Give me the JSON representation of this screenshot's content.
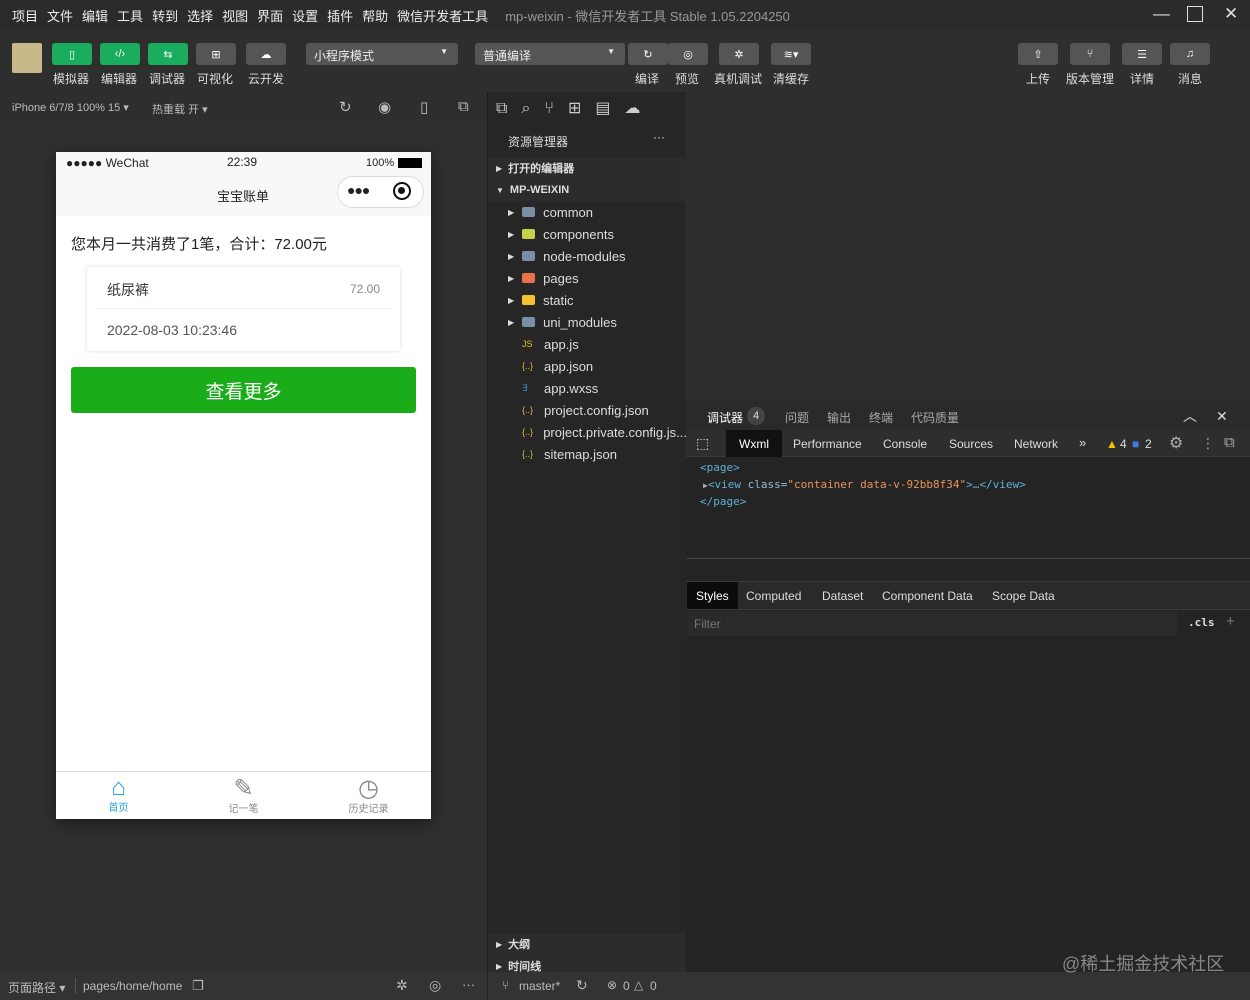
{
  "menubar": {
    "items": [
      "项目",
      "文件",
      "编辑",
      "工具",
      "转到",
      "选择",
      "视图",
      "界面",
      "设置",
      "插件",
      "帮助",
      "微信开发者工具"
    ],
    "title": "mp-weixin - 微信开发者工具 Stable 1.05.2204250"
  },
  "toolbar": {
    "left": [
      {
        "label": "模拟器",
        "icon": "phone-icon"
      },
      {
        "label": "编辑器",
        "icon": "code-icon"
      },
      {
        "label": "调试器",
        "icon": "sliders-icon"
      },
      {
        "label": "可视化",
        "icon": "layout-icon"
      },
      {
        "label": "云开发",
        "icon": "cloud-icon"
      }
    ],
    "mode_select": "小程序模式",
    "compile_select": "普通编译",
    "middle": [
      {
        "label": "编译",
        "icon": "refresh-icon"
      },
      {
        "label": "预览",
        "icon": "eye-icon"
      },
      {
        "label": "真机调试",
        "icon": "bug-icon"
      },
      {
        "label": "清缓存",
        "icon": "layers-icon"
      }
    ],
    "right": [
      {
        "label": "上传",
        "icon": "upload-icon"
      },
      {
        "label": "版本管理",
        "icon": "branch-icon"
      },
      {
        "label": "详情",
        "icon": "menu-icon"
      },
      {
        "label": "消息",
        "icon": "bell-icon"
      }
    ],
    "accent": "#1aad5f"
  },
  "subbar": {
    "device": "iPhone 6/7/8 100% 15 ▾",
    "hot_reload": "热重载 开 ▾"
  },
  "phone": {
    "status": {
      "carrier": "●●●●● WeChat",
      "time": "22:39",
      "battery": "100%"
    },
    "nav_title": "宝宝账单",
    "summary": "您本月一共消费了1笔，合计：72.00元",
    "record": {
      "name": "纸尿裤",
      "amount": "72.00",
      "time": "2022-08-03 10:23:46"
    },
    "more_button": "查看更多",
    "button_color": "#1aad19",
    "tabbar": [
      {
        "label": "首页",
        "icon": "home-icon",
        "active": true
      },
      {
        "label": "记一笔",
        "icon": "pencil-icon"
      },
      {
        "label": "历史记录",
        "icon": "history-icon"
      }
    ]
  },
  "explorer": {
    "title": "资源管理器",
    "more": "···",
    "open_editors": "打开的编辑器",
    "root": "MP-WEIXIN",
    "folders": [
      {
        "name": "common",
        "color": "#7a8fa6"
      },
      {
        "name": "components",
        "color": "#c5d34a"
      },
      {
        "name": "node-modules",
        "color": "#7a8fa6"
      },
      {
        "name": "pages",
        "color": "#e8734a"
      },
      {
        "name": "static",
        "color": "#f2c12e"
      },
      {
        "name": "uni_modules",
        "color": "#7a8fa6"
      }
    ],
    "files": [
      {
        "name": "app.js",
        "icon": "js-file-icon",
        "symbol": "JS",
        "color": "#e8c21c"
      },
      {
        "name": "app.json",
        "icon": "json-file-icon",
        "symbol": "{..}",
        "color": "#d4b84a"
      },
      {
        "name": "app.wxss",
        "icon": "css-file-icon",
        "symbol": "∃",
        "color": "#3c8fd6"
      },
      {
        "name": "project.config.json",
        "icon": "json-file-icon",
        "symbol": "{..}",
        "color": "#d4b84a"
      },
      {
        "name": "project.private.config.js...",
        "icon": "json-file-icon",
        "symbol": "{..}",
        "color": "#d4b84a"
      },
      {
        "name": "sitemap.json",
        "icon": "json-file-icon",
        "symbol": "{..}",
        "color": "#d4b84a"
      }
    ],
    "outline": "大纲",
    "timeline": "时间线"
  },
  "debug": {
    "tabs": [
      "调试器",
      "问题",
      "输出",
      "终端",
      "代码质量"
    ],
    "badge": "4",
    "devtabs": [
      "Wxml",
      "Performance",
      "Console",
      "Sources",
      "Network"
    ],
    "warnings": "4",
    "infos": "2",
    "wxml": {
      "open": "<page>",
      "view_open": "<view ",
      "attr": "class=",
      "value": "\"container data-v-92bb8f34\"",
      "rest": ">…</view>",
      "close": "</page>"
    },
    "subtabs": [
      "Styles",
      "Computed",
      "Dataset",
      "Component Data",
      "Scope Data"
    ],
    "filter_placeholder": "Filter",
    "cls": ".cls",
    "plus": "+"
  },
  "status": {
    "path_label": "页面路径 ▾",
    "path": "pages/home/home",
    "branch": "master*",
    "errors": "0",
    "warns": "0"
  },
  "watermark": "@稀土掘金技术社区"
}
